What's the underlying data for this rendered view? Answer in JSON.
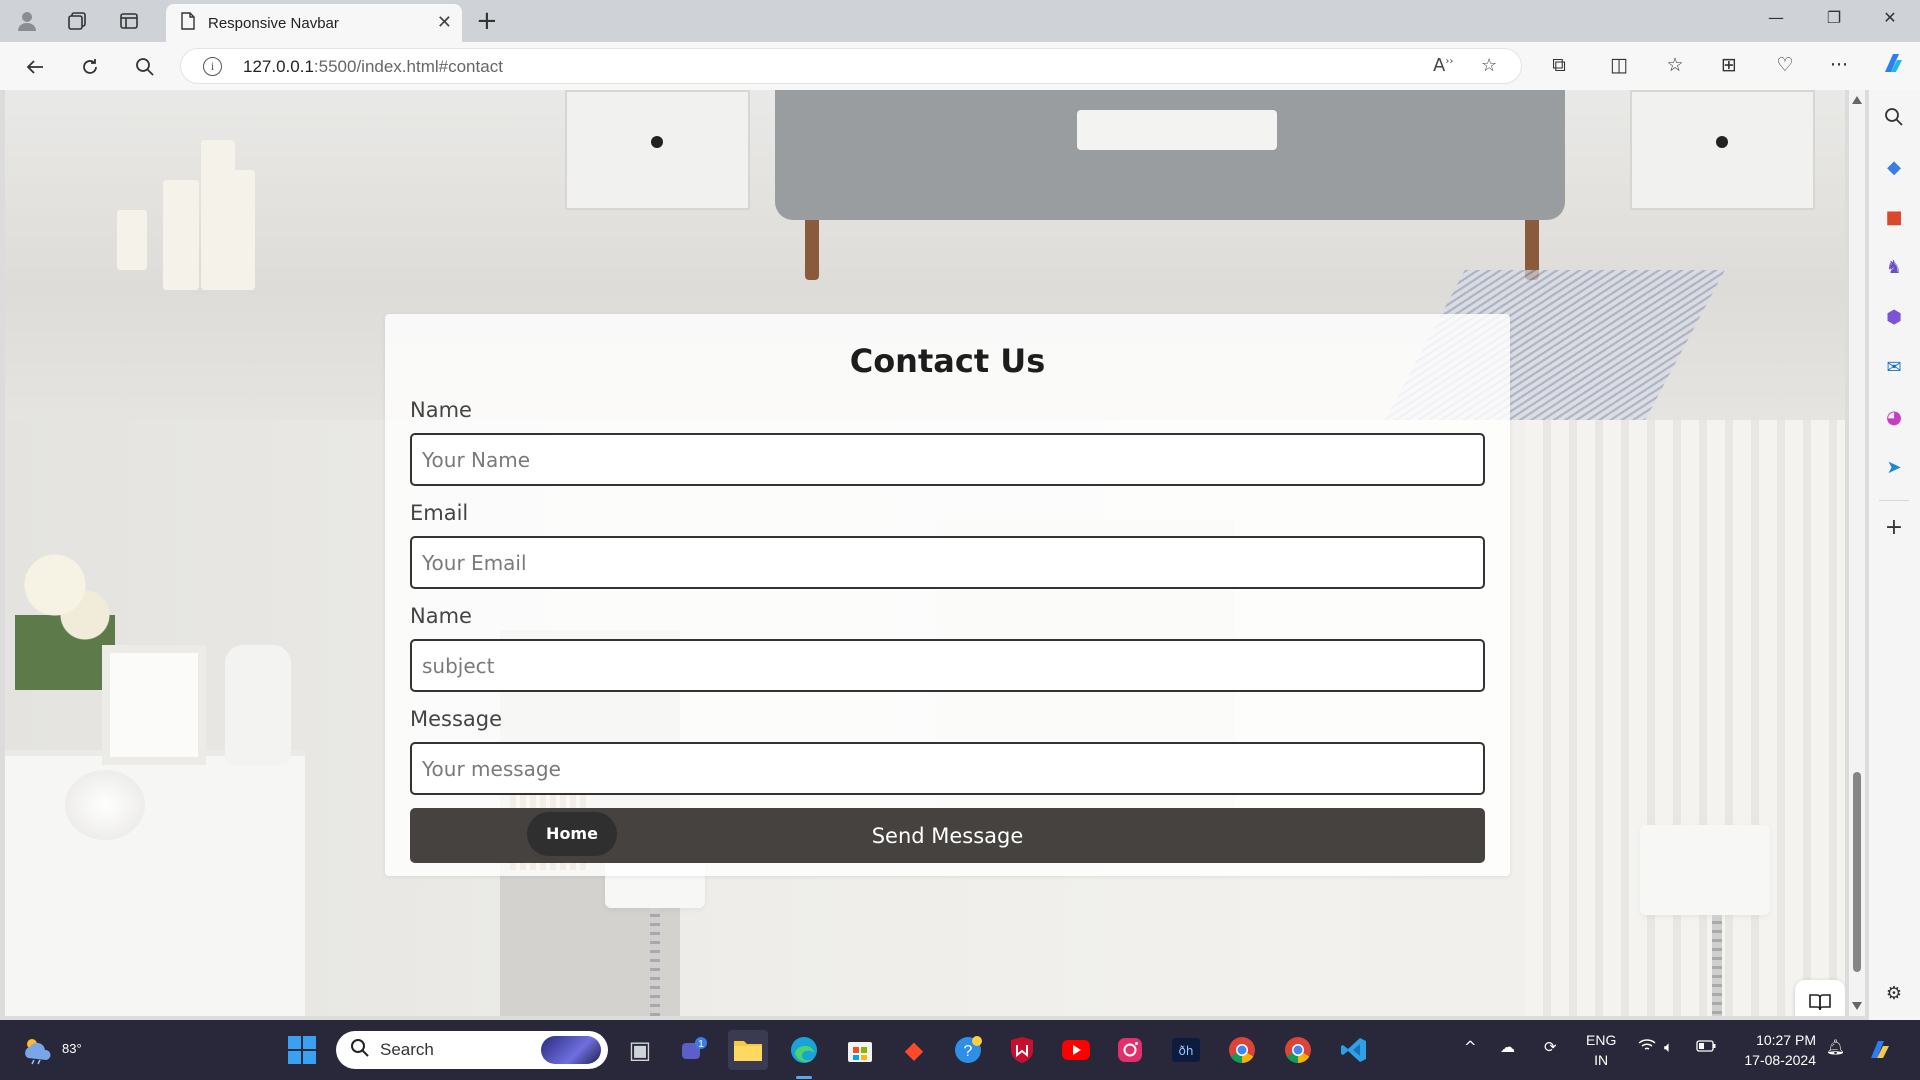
{
  "browser": {
    "tab_title": "Responsive Navbar",
    "url_host": "127.0.0.1",
    "url_rest": ":5500/index.html#contact"
  },
  "contact": {
    "title": "Contact Us",
    "fields": [
      {
        "label": "Name",
        "placeholder": "Your Name",
        "value": ""
      },
      {
        "label": "Email",
        "placeholder": "Your Email",
        "value": ""
      },
      {
        "label": "Name",
        "placeholder": "subject",
        "value": ""
      },
      {
        "label": "Message",
        "placeholder": "Your message",
        "value": ""
      }
    ],
    "submit_label": "Send Message"
  },
  "page": {
    "home_label": "Home"
  },
  "taskbar": {
    "temperature": "83°",
    "search_placeholder": "Search",
    "language_line1": "ENG",
    "language_line2": "IN",
    "time": "10:27 PM",
    "date": "17-08-2024",
    "teams_badge": "1"
  },
  "colors": {
    "button_dark": "#45423f",
    "home_pill": "#2f2f2f",
    "taskbar": "#28283a"
  }
}
